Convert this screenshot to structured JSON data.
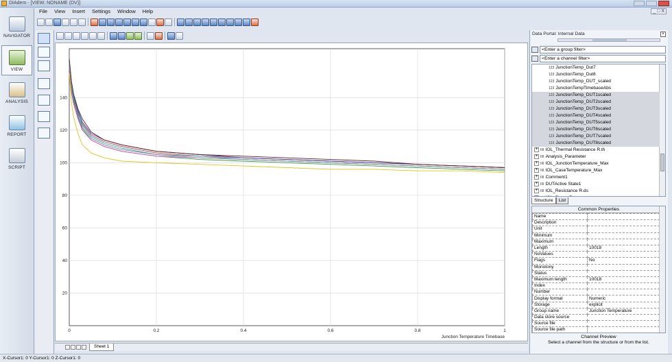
{
  "window": {
    "title": "DIAdem - [VIEW: NONAME (DV)]",
    "mdi_controls": "_ □ X"
  },
  "menu": [
    "File",
    "View",
    "Insert",
    "Settings",
    "Window",
    "Help"
  ],
  "nav": [
    {
      "label": "NAVIGATOR",
      "icon": "navigator-icon"
    },
    {
      "label": "VIEW",
      "icon": "view-icon"
    },
    {
      "label": "ANALYSIS",
      "icon": "analysis-icon"
    },
    {
      "label": "REPORT",
      "icon": "report-icon"
    },
    {
      "label": "SCRIPT",
      "icon": "script-icon"
    }
  ],
  "chart_data": {
    "type": "line",
    "xlabel": "Junction Temperature Timebase",
    "ylabel": "",
    "xlim": [
      0,
      1
    ],
    "ylim": [
      0,
      170
    ],
    "x_ticks": [
      "0",
      "0.2",
      "0.4",
      "0.6",
      "0.8",
      "1"
    ],
    "y_ticks": [
      "20",
      "40",
      "60",
      "80",
      "100",
      "120",
      "140"
    ],
    "grid": true,
    "x": [
      0,
      0.005,
      0.01,
      0.02,
      0.03,
      0.05,
      0.08,
      0.12,
      0.2,
      0.3,
      0.4,
      0.5,
      0.6,
      0.7,
      0.8,
      0.9,
      1.0
    ],
    "series": [
      {
        "color": "#c0392b",
        "values": [
          160,
          146,
          139,
          130,
          124,
          117,
          113,
          110,
          106,
          104,
          103,
          102,
          101,
          100,
          99,
          98,
          97
        ]
      },
      {
        "color": "#2e9e3a",
        "values": [
          162,
          147,
          138,
          128,
          121,
          114,
          110,
          107,
          104,
          102,
          101,
          100,
          99,
          98,
          97,
          96,
          95
        ]
      },
      {
        "color": "#1f3fbf",
        "values": [
          163,
          149,
          141,
          132,
          125,
          118,
          114,
          111,
          107,
          105,
          103,
          102,
          101,
          100,
          99,
          98,
          97
        ]
      },
      {
        "color": "#d94cd0",
        "values": [
          158,
          143,
          136,
          127,
          120,
          114,
          110,
          107,
          104,
          103,
          102,
          101,
          100,
          99,
          98,
          97,
          96
        ]
      },
      {
        "color": "#2aa7c9",
        "values": [
          161,
          148,
          140,
          131,
          123,
          116,
          112,
          109,
          105,
          104,
          102,
          101,
          100,
          99,
          98,
          97,
          96
        ]
      },
      {
        "color": "#8a8a8a",
        "values": [
          159,
          145,
          137,
          129,
          122,
          115,
          111,
          108,
          105,
          103,
          102,
          101,
          100,
          99,
          98,
          97,
          96
        ]
      },
      {
        "color": "#e6c21a",
        "values": [
          155,
          137,
          128,
          118,
          111,
          106,
          103,
          101,
          100,
          99,
          98,
          97,
          96,
          96,
          95,
          95,
          94
        ]
      },
      {
        "color": "#6b1a1a",
        "values": [
          164,
          150,
          142,
          133,
          127,
          119,
          114,
          111,
          107,
          105,
          104,
          103,
          102,
          101,
          99,
          98,
          97
        ]
      }
    ]
  },
  "sheet": {
    "tab": "Sheet 1"
  },
  "status": "X-Cursor1: 0 Y-Cursor1: 0 Z-Cursor1: 0",
  "portal": {
    "title": "Data Portal: Internal Data",
    "group_filter": "<Enter a group filter>",
    "channel_filter": "<Enter a channel filter>",
    "channels": [
      "JunctionTemp_Dut7",
      "JunctionTemp_Dut8",
      "JunctionTemp_DUT_scaled",
      "JunctionTempTimebaseAbs",
      "JunctionTemp_DUT1scaled",
      "JunctionTemp_DUT2scaled",
      "JunctionTemp_DUT3scaled",
      "JunctionTemp_DUT4scaled",
      "JunctionTemp_DUT5scaled",
      "JunctionTemp_DUT6scaled",
      "JunctionTemp_DUT7scaled",
      "JunctionTemp_DUT8scaled"
    ],
    "groups": [
      "IOL_Thermal Resistance R.th",
      "Analysis_Parameter",
      "IOL_JunctionTemperature_Max",
      "IOL_CaseTemperature_Max",
      "Comment1",
      "DUTActive State1",
      "IOL_Resistance R.ds",
      "IOL_Power P.v_max"
    ],
    "tabs": [
      "Structure",
      "List"
    ],
    "props_title": "Common Properties",
    "props": [
      [
        "Name",
        ""
      ],
      [
        "Description",
        ""
      ],
      [
        "Unit",
        ""
      ],
      [
        "Minimum",
        ""
      ],
      [
        "Maximum",
        ""
      ],
      [
        "Length",
        "10018"
      ],
      [
        "NoValues",
        ""
      ],
      [
        "Flags",
        "No"
      ],
      [
        "Monotony",
        ""
      ],
      [
        "Status",
        ""
      ],
      [
        "Maximum length",
        "10018"
      ],
      [
        "Index",
        ""
      ],
      [
        "Number",
        ""
      ],
      [
        "Display format",
        "Numeric"
      ],
      [
        "Storage",
        "explicit"
      ],
      [
        "Group name",
        "Junction Temperature"
      ],
      [
        "Data store source",
        ""
      ],
      [
        "Source file",
        ""
      ],
      [
        "Source file path",
        ""
      ]
    ],
    "preview_title": "Channel Preview",
    "preview_text": "Select a channel from the structure or from the list."
  }
}
